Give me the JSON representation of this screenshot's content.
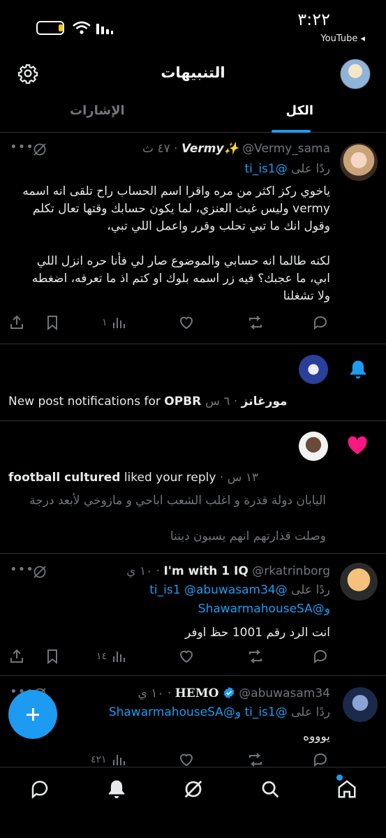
{
  "status_bar": {
    "time": "٣:٢٢",
    "app_label": "YouTube ◂"
  },
  "header": {
    "title": "التنبيهات"
  },
  "tabs": [
    {
      "label": "الكل",
      "active": true
    },
    {
      "label": "الإشارات",
      "active": false
    }
  ],
  "post1": {
    "display_name": "Vermy✨",
    "handle": "@Vermy_sama",
    "time": "٤٧ ث",
    "replying_prefix": "ردًا على",
    "replying_to": "@ti_is1",
    "body": [
      "ياخوي ركز اكثر من مره واقرا اسم الحساب راح تلقى انه اسمه",
      "vermy وليس غيث العنزي، لما يكون حسابك وقتها تعال تكلم",
      "وقول انك ما تبي تحلب وقرر واعمل اللي تبي،",
      "",
      "لكنه طالما انه حسابي والموضوع صار لي فأنا حره انزل اللي",
      "ابي، ما عجبك؟ فيه زر اسمه بلوك او كتم اذ ما تعرفه، اضغطه",
      "ولا تشغلنا"
    ],
    "views": "١"
  },
  "notif1": {
    "text_prefix": "New post notifications for ",
    "account": "OPBR مورغانز",
    "time": "٦ س"
  },
  "notif2": {
    "actor": "football cultured",
    "action": " liked your reply",
    "time": "١٣ س",
    "quote_lines": [
      "اليابان دولة قذرة و اغلب الشعب اباحي و مازوخي لأبعد درجة",
      "وصلت قذارتهم انهم يسبون ديننا"
    ]
  },
  "post2": {
    "display_name": "I'm with 1 IQ",
    "handle": "@rkatrinborg",
    "time": "١٠ ي",
    "replying_prefix": "ردًا على",
    "replying_to_1": "@abuwasam34",
    "replying_to_2": "@ti_is1",
    "replying_and": "و",
    "replying_to_3": "@ShawarmahouseSA",
    "body": "انت الرد رقم 1001 حظ اوفر",
    "views": "١٤"
  },
  "post3": {
    "display_name": "HEMO",
    "handle": "@abuwasam34",
    "time": "١٠ ي",
    "replying_prefix": "ردًا على",
    "replying_to_1": "@ti_is1",
    "replying_and": "و",
    "replying_to_2": "@ShawarmahouseSA",
    "body": "يوووه",
    "views": "٤٢١"
  },
  "colors": {
    "accent": "#1d9bf0",
    "like": "#f91880",
    "muted": "#71767b",
    "verified": "#1d9bf0"
  }
}
